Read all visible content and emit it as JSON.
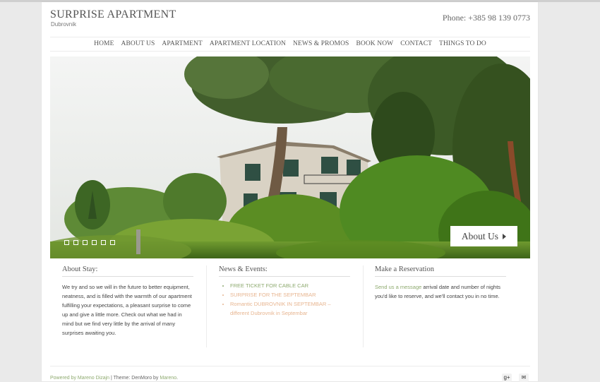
{
  "site": {
    "title": "SURPRISE APARTMENT",
    "subtitle": "Dubrovnik",
    "phone": "Phone: +385 98 139 0773"
  },
  "nav": [
    {
      "label": "HOME"
    },
    {
      "label": "ABOUT US"
    },
    {
      "label": "APARTMENT"
    },
    {
      "label": "APARTMENT LOCATION"
    },
    {
      "label": "NEWS & PROMOS"
    },
    {
      "label": "BOOK NOW"
    },
    {
      "label": "CONTACT"
    },
    {
      "label": "THINGS TO DO"
    }
  ],
  "hero": {
    "button_label": "About Us",
    "slide_count": 6,
    "image": "villa-among-pine-trees"
  },
  "about": {
    "heading": "About Stay:",
    "text": "We try and so we will in the future to better equipment, neatness, and is filled with the warmth of our apartment fulfilling your expectations, a pleasant surprise to come up and give a little more. Check out what we had in mind but we find very little by the arrival of many surprises awaiting you."
  },
  "news": {
    "heading": "News & Events:",
    "items": [
      {
        "label": "FREE TICKET FOR CABLE CAR"
      },
      {
        "label": "SURPRISE FOR THE SEPTEMBAR"
      },
      {
        "label": "Romantic DUBROVNIK IN SEPTEMBAR – different Dubrovnik in Septembar"
      }
    ]
  },
  "reservation": {
    "heading": "Make a Reservation",
    "link_text": "Send us a message",
    "text": " arrival date and number of nights you'd like to reserve, and we'll contact you in no time."
  },
  "footer": {
    "powered_by": "Powered by Mareno Dizajn",
    "separator": " | Theme: DenMoro by ",
    "theme_author": "Mareno",
    "end": ".",
    "icons": [
      "google-plus-icon",
      "mail-icon"
    ]
  },
  "colors": {
    "link_green": "#8eaa6f",
    "link_peach": "#e7b590",
    "background": "#eaeaea"
  }
}
